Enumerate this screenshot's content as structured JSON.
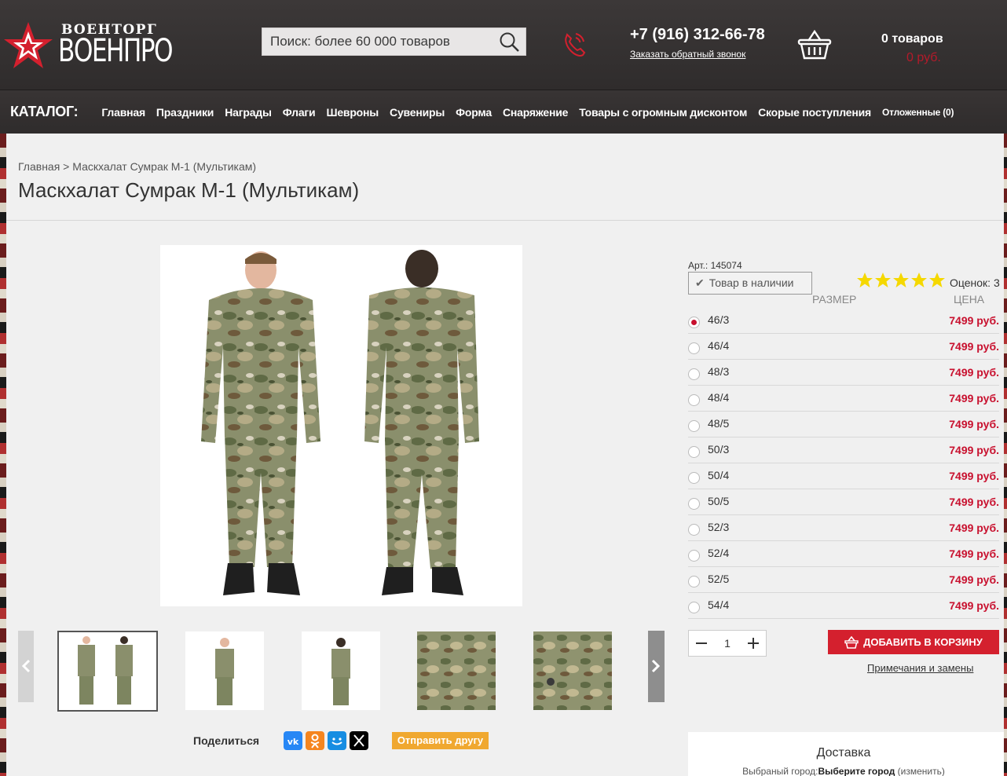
{
  "header": {
    "logo_top": "ВОЕНТОРГ",
    "logo_main": "ВОЕНПРО",
    "search_placeholder": "Поиск: более 60 000 товаров",
    "phone": "+7 (916) 312-66-78",
    "callback_label": "Заказать обратный звонок",
    "cart_count": "0 товаров",
    "cart_sum": "0 руб."
  },
  "nav": {
    "title": "КАТАЛОГ:",
    "items": [
      "Главная",
      "Праздники",
      "Награды",
      "Флаги",
      "Шевроны",
      "Сувениры",
      "Форма",
      "Снаряжение",
      "Товары с огромным дисконтом",
      "Скорые поступления"
    ],
    "postponed": "Отложенные (0)"
  },
  "breadcrumb": {
    "home": "Главная",
    "separator": " > ",
    "current": "Маскхалат Сумрак М-1 (Мультикам)"
  },
  "product": {
    "title": "Маскхалат Сумрак М-1 (Мультикам)",
    "article": "Арт.: 145074",
    "in_stock": "Товар в наличии",
    "rating_stars": 5,
    "rating_text": "Оценок: 3",
    "size_header": "РАЗМЕР",
    "price_header": "ЦЕНА",
    "sizes": [
      {
        "size": "46/3",
        "price": "7499 руб.",
        "selected": true
      },
      {
        "size": "46/4",
        "price": "7499 руб.",
        "selected": false
      },
      {
        "size": "48/3",
        "price": "7499 руб.",
        "selected": false
      },
      {
        "size": "48/4",
        "price": "7499 руб.",
        "selected": false
      },
      {
        "size": "48/5",
        "price": "7499 руб.",
        "selected": false
      },
      {
        "size": "50/3",
        "price": "7499 руб.",
        "selected": false
      },
      {
        "size": "50/4",
        "price": "7499 руб.",
        "selected": false
      },
      {
        "size": "50/5",
        "price": "7499 руб.",
        "selected": false
      },
      {
        "size": "52/3",
        "price": "7499 руб.",
        "selected": false
      },
      {
        "size": "52/4",
        "price": "7499 руб.",
        "selected": false
      },
      {
        "size": "52/5",
        "price": "7499 руб.",
        "selected": false
      },
      {
        "size": "54/4",
        "price": "7499 руб.",
        "selected": false
      }
    ],
    "quantity": "1",
    "add_to_cart": "ДОБАВИТЬ В КОРЗИНУ",
    "notes_link": "Примечания и замены"
  },
  "share": {
    "label": "Поделиться",
    "networks": [
      "vk-icon",
      "ok-icon",
      "moimir-icon",
      "x-icon"
    ],
    "send_friend": "Отправить другу"
  },
  "delivery": {
    "title": "Доставка",
    "city_prefix": "Выбраный город:",
    "city_choose": "Выберите город",
    "city_change": " (изменить)"
  },
  "colors": {
    "accent_red": "#d4202e",
    "price_red": "#c8102e",
    "header_bg": "#3a3535",
    "share_orange": "#f0a830",
    "star_yellow": "#f5d800"
  }
}
